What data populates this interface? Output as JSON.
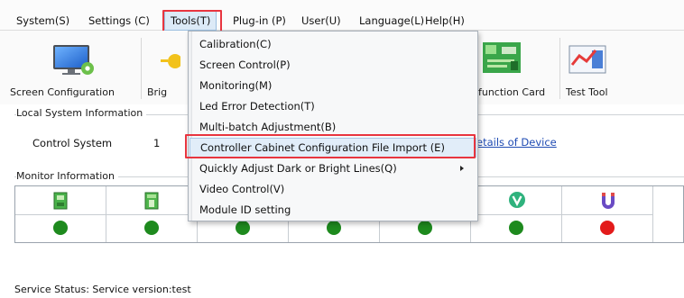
{
  "menubar": {
    "items": [
      "System(S)",
      "Settings (C)",
      "Tools(T)",
      "Plug-in (P)",
      "User(U)",
      "Language(L)",
      "Help(H)"
    ]
  },
  "toolbar": {
    "screen_configuration": "Screen Configuration",
    "brightness_partial": "Brig",
    "function_card_partial": "-function Card",
    "test_tool": "Test Tool"
  },
  "local_system": {
    "title": "Local System Information",
    "control_system_label": "Control System",
    "control_system_value": "1",
    "details_link": "etails of Device"
  },
  "monitor": {
    "title": "Monitor Information",
    "statuses": [
      "green",
      "green",
      "green",
      "green",
      "green",
      "green",
      "red"
    ]
  },
  "status_bar": {
    "text": "Service Status:  Service version:test"
  },
  "tools_menu": {
    "items": [
      "Calibration(C)",
      "Screen Control(P)",
      "Monitoring(M)",
      "Led Error Detection(T)",
      "Multi-batch Adjustment(B)",
      "Controller Cabinet Configuration File Import (E)",
      "Quickly Adjust Dark or Bright Lines(Q)",
      "Video Control(V)",
      "Module ID setting"
    ]
  },
  "colors": {
    "highlight_box": "#e8353f",
    "status_green": "#1e8a1e",
    "status_red": "#e31b1b",
    "link": "#1f4bb3"
  },
  "icons": {
    "screen_configuration": "monitor-gear-icon",
    "brightness": "sun-icon",
    "function_card": "circuit-board-icon",
    "test_tool": "chart-icon",
    "monitor_icons": [
      "chip-icon",
      "chip-icon",
      "",
      "",
      "",
      "video-v-icon",
      "magnet-icon"
    ]
  }
}
